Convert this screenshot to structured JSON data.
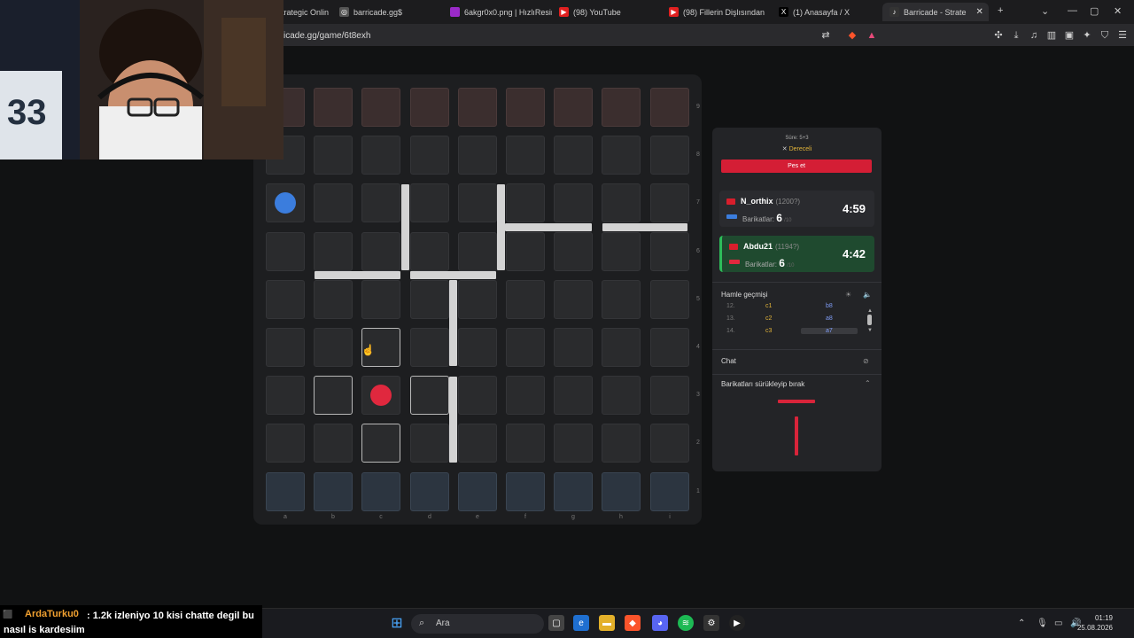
{
  "browser": {
    "tabs": [
      {
        "label": "trategic Onlin",
        "icon": "",
        "color": "#444"
      },
      {
        "label": "barricade.gg$",
        "icon": "globe-icon",
        "color": "#555"
      },
      {
        "label": "6akgr0x0.png | HızlıResim",
        "icon": "image-icon",
        "color": "#9b2ac9"
      },
      {
        "label": "(98) YouTube",
        "icon": "youtube-icon",
        "color": "#e02020"
      },
      {
        "label": "(98) Fillerin Dişlısından ei",
        "icon": "youtube-icon",
        "color": "#e02020"
      },
      {
        "label": "(1) Anasayfa / X",
        "icon": "x-icon",
        "color": "#000"
      },
      {
        "label": "Barricade - Strate",
        "icon": "speaker-icon",
        "color": "#333"
      }
    ],
    "new_tab": "+",
    "url": "icade.gg/game/6t8exh"
  },
  "board": {
    "files": [
      "a",
      "b",
      "c",
      "d",
      "e",
      "f",
      "g",
      "h",
      "i"
    ],
    "ranks": [
      "9",
      "8",
      "7",
      "6",
      "5",
      "4",
      "3",
      "2",
      "1"
    ],
    "blue_pawn": {
      "file": "a",
      "rank": 7
    },
    "red_pawn": {
      "file": "c",
      "rank": 3
    },
    "highlighted_cells": [
      [
        "c",
        4
      ],
      [
        "b",
        3
      ],
      [
        "d",
        3
      ],
      [
        "c",
        2
      ]
    ],
    "colors": {
      "blue": "#3b7ddd",
      "red": "#e0283e"
    }
  },
  "sidebar": {
    "time_control": "Süre: 5+3",
    "mode": "Dereceli",
    "resign_label": "Pes et",
    "players": [
      {
        "name": "N_orthix",
        "rating": "(1200?)",
        "barricades_label": "Barikatlar:",
        "barricades": "6",
        "barricades_max": "/10",
        "clock": "4:59",
        "color": "#3b7ddd",
        "active": false
      },
      {
        "name": "Abdu21",
        "rating": "(1194?)",
        "barricades_label": "Barikatlar:",
        "barricades": "6",
        "barricades_max": "/10",
        "clock": "4:42",
        "color": "#e0283e",
        "active": true
      }
    ],
    "history_title": "Hamle geçmişi",
    "history": [
      {
        "n": "12.",
        "m1": "c1",
        "m2": "b8"
      },
      {
        "n": "13.",
        "m1": "c2",
        "m2": "a8"
      },
      {
        "n": "14.",
        "m1": "c3",
        "m2": "a7"
      }
    ],
    "chat_title": "Chat",
    "drag_title": "Barikatları sürükleyip bırak"
  },
  "stream_chat": {
    "user": "ArdaTurku0",
    "message": ": 1.2k izleniyo 10 kisi chatte degil bu nasıl is kardesiim"
  },
  "taskbar": {
    "search": "Ara",
    "time": "01:19",
    "date": "25.08.2026"
  }
}
